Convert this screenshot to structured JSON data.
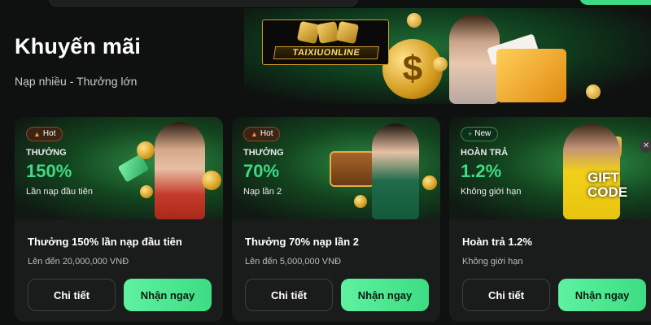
{
  "hero": {
    "title": "Khuyến mãi",
    "subtitle": "Nạp nhiều - Thưởng lớn",
    "logo_text": "TAIXIUONLINE"
  },
  "cards": [
    {
      "badge": "Hot",
      "badge_icon": "fire-icon",
      "kicker": "THƯỞNG",
      "value": "150%",
      "note": "Lần nạp đầu tiên",
      "title": "Thưởng 150% lần nạp đầu tiên",
      "desc": "Lên đến 20,000,000 VNĐ",
      "detail_label": "Chi tiết",
      "claim_label": "Nhận ngay"
    },
    {
      "badge": "Hot",
      "badge_icon": "fire-icon",
      "kicker": "THƯỞNG",
      "value": "70%",
      "note": "Nạp lần 2",
      "title": "Thưởng 70% nạp lần 2",
      "desc": "Lên đến 5,000,000 VNĐ",
      "detail_label": "Chi tiết",
      "claim_label": "Nhận ngay"
    },
    {
      "badge": "New",
      "badge_icon": "plus-icon",
      "kicker": "HOÀN TRẢ",
      "value": "1.2%",
      "note": "Không giới hạn",
      "title": "Hoàn trả 1.2%",
      "desc": "Không giới hạn",
      "detail_label": "Chi tiết",
      "claim_label": "Nhận ngay",
      "art_text": "GIFT CODE"
    }
  ],
  "colors": {
    "accent": "#3ddc84",
    "background": "#0f1110",
    "card": "#1a1c1b"
  }
}
